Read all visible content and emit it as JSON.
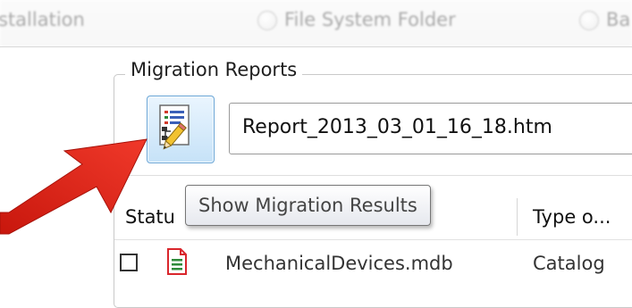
{
  "install_options": [
    {
      "label": "stallation",
      "radio_name": "radio-installation"
    },
    {
      "label": "File System Folder",
      "radio_name": "radio-file-system-folder"
    },
    {
      "label": "Ba",
      "radio_name": "radio-ba"
    }
  ],
  "migration_reports": {
    "title": "Migration Reports",
    "button_icon": "report-edit-icon",
    "selected_report": "Report_2013_03_01_16_18.htm",
    "tooltip": "Show Migration Results"
  },
  "results_list": {
    "columns": [
      "Statu",
      "Type o..."
    ],
    "rows": [
      {
        "name": "MechanicalDevices.mdb",
        "type": "Catalog",
        "icon": "document-icon",
        "checked": false
      }
    ]
  },
  "colors": {
    "arrow": "#e0261a",
    "button_border": "#6aa5d6",
    "file_icon": "#d9262c"
  }
}
